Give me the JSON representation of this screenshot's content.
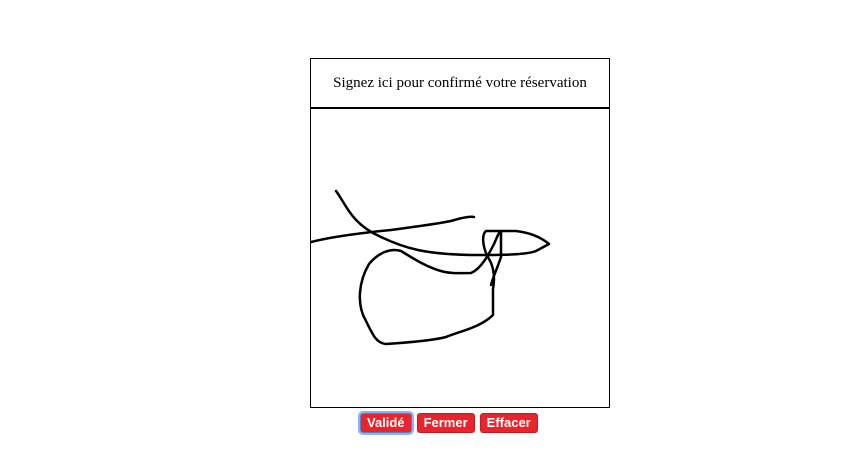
{
  "signature": {
    "header": "Signez ici pour confirmé votre réservation"
  },
  "buttons": {
    "validate": "Validé",
    "close": "Fermer",
    "clear": "Effacer"
  },
  "colors": {
    "button_bg": "#e8242c",
    "button_text": "#ffffff",
    "ink": "#000000"
  }
}
